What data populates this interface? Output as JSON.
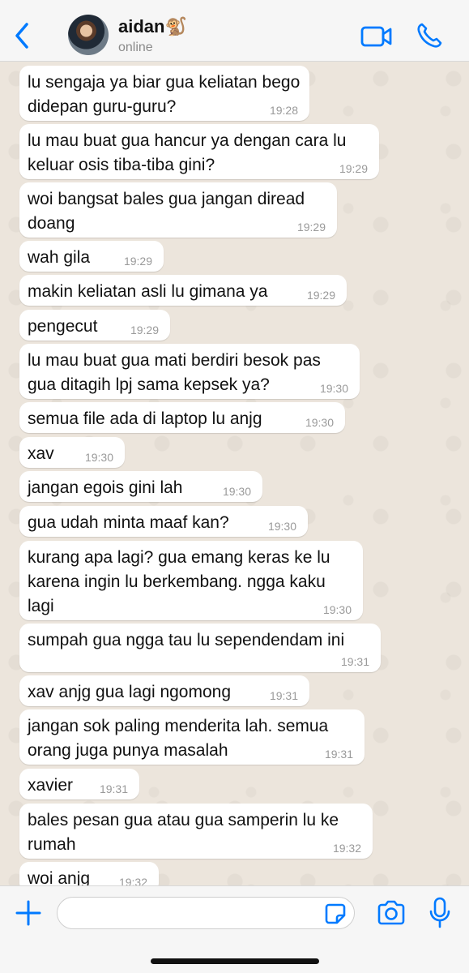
{
  "header": {
    "contact_name": "aidan",
    "contact_emoji": "🐒",
    "status": "online",
    "accent_color": "#007aff"
  },
  "messages": [
    {
      "text": "lu sengaja ya biar gua keliatan bego\ndidepan guru-guru?",
      "time": "19:28"
    },
    {
      "text": "lu mau buat gua hancur ya dengan cara lu\nkeluar osis tiba-tiba gini?",
      "time": "19:29"
    },
    {
      "text": "woi bangsat bales gua jangan diread\ndoang",
      "time": "19:29"
    },
    {
      "text": "wah gila",
      "time": "19:29"
    },
    {
      "text": "makin keliatan asli lu gimana ya",
      "time": "19:29"
    },
    {
      "text": "pengecut",
      "time": "19:29"
    },
    {
      "text": "lu mau buat gua mati berdiri besok pas\ngua ditagih lpj sama kepsek ya?",
      "time": "19:30"
    },
    {
      "text": "semua file ada di laptop lu anjg",
      "time": "19:30"
    },
    {
      "text": "xav",
      "time": "19:30"
    },
    {
      "text": "jangan egois gini lah",
      "time": "19:30"
    },
    {
      "text": "gua udah minta maaf kan?",
      "time": "19:30"
    },
    {
      "text": "kurang apa lagi? gua emang keras ke lu\nkarena ingin lu berkembang. ngga kaku\nlagi",
      "time": "19:30"
    },
    {
      "text": "sumpah gua ngga tau lu sependendam ini",
      "time": "19:31"
    },
    {
      "text": "xav anjg gua lagi ngomong",
      "time": "19:31"
    },
    {
      "text": "jangan sok paling menderita lah. semua\norang juga punya masalah",
      "time": "19:31"
    },
    {
      "text": "xavier",
      "time": "19:31"
    },
    {
      "text": "bales pesan gua atau gua samperin lu ke\nrumah",
      "time": "19:32"
    },
    {
      "text": "woi anjg",
      "time": "19:32"
    }
  ],
  "input": {
    "value": "",
    "placeholder": ""
  },
  "icons": {
    "back": "chevron-left-icon",
    "video": "video-camera-icon",
    "call": "phone-icon",
    "attach": "plus-icon",
    "sticker": "sticker-icon",
    "camera": "camera-icon",
    "mic": "microphone-icon"
  }
}
